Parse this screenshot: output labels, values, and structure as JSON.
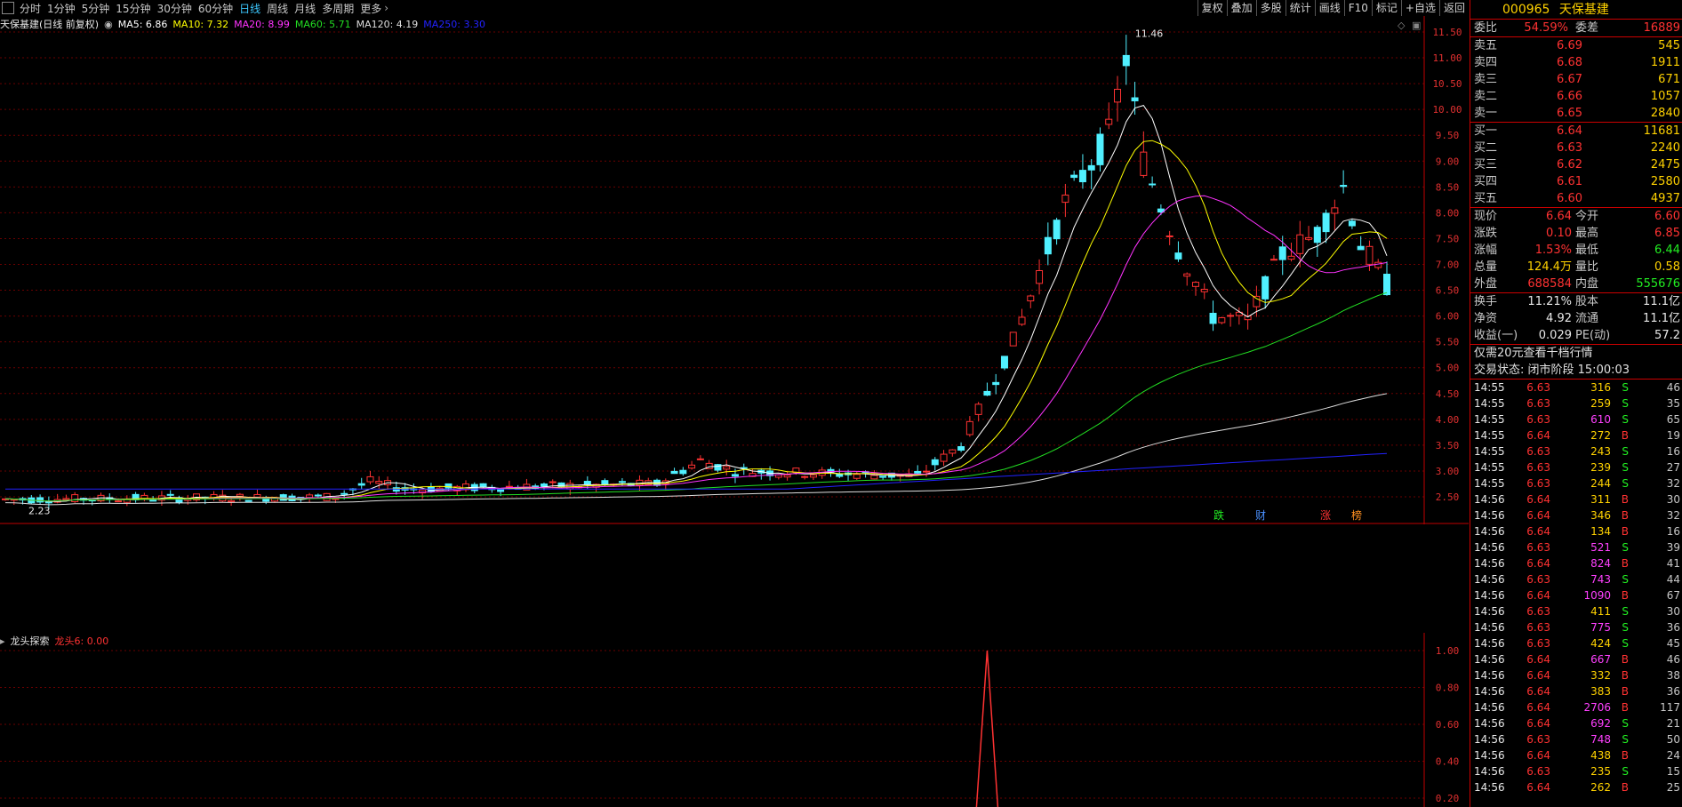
{
  "toolbar": {
    "periods": [
      "分时",
      "1分钟",
      "5分钟",
      "15分钟",
      "30分钟",
      "60分钟",
      "日线",
      "周线",
      "月线",
      "多周期",
      "更多"
    ],
    "active_period": "日线",
    "right_buttons": [
      "复权",
      "叠加",
      "多股",
      "统计",
      "画线",
      "F10",
      "标记",
      "+自选",
      "返回"
    ]
  },
  "chart": {
    "stock_title": "天保基建(日线 前复权)",
    "ma_legend": [
      {
        "label": "MA5: 6.86",
        "color": "#ffffff"
      },
      {
        "label": "MA10: 7.32",
        "color": "#ffff00"
      },
      {
        "label": "MA20: 8.99",
        "color": "#ff33ff"
      },
      {
        "label": "MA60: 5.71",
        "color": "#22dd22"
      },
      {
        "label": "MA120: 4.19",
        "color": "#dddddd"
      },
      {
        "label": "MA250: 3.30",
        "color": "#2222ff"
      }
    ],
    "high_label": "11.46",
    "low_label": "2.23",
    "event_marks": [
      {
        "label": "跌",
        "color": "#22ee22"
      },
      {
        "label": "财",
        "color": "#4a90ff"
      },
      {
        "label": "涨",
        "color": "#ff3232"
      },
      {
        "label": "榜",
        "color": "#ff9020"
      }
    ],
    "y_ticks": [
      "11.50",
      "11.00",
      "10.50",
      "10.00",
      "9.50",
      "9.00",
      "8.50",
      "8.00",
      "7.50",
      "7.00",
      "6.50",
      "6.00",
      "5.50",
      "5.00",
      "4.50",
      "4.00",
      "3.50",
      "3.00",
      "2.50"
    ],
    "colors": {
      "up": "#ff3232",
      "down": "#50f0ff",
      "grid": "#7a0000"
    }
  },
  "sub": {
    "name": "龙头探索",
    "value_label": "龙头6: 0.00",
    "y_ticks": [
      "1.00",
      "0.80",
      "0.60",
      "0.40",
      "0.20"
    ]
  },
  "panel": {
    "code": "000965",
    "name": "天保基建",
    "weibi": {
      "label": "委比",
      "value": "54.59%",
      "label2": "委差",
      "value2": "16889"
    },
    "asks": [
      {
        "label": "卖五",
        "price": "6.69",
        "vol": "545"
      },
      {
        "label": "卖四",
        "price": "6.68",
        "vol": "1911"
      },
      {
        "label": "卖三",
        "price": "6.67",
        "vol": "671"
      },
      {
        "label": "卖二",
        "price": "6.66",
        "vol": "1057"
      },
      {
        "label": "卖一",
        "price": "6.65",
        "vol": "2840"
      }
    ],
    "bids": [
      {
        "label": "买一",
        "price": "6.64",
        "vol": "11681"
      },
      {
        "label": "买二",
        "price": "6.63",
        "vol": "2240"
      },
      {
        "label": "买三",
        "price": "6.62",
        "vol": "2475"
      },
      {
        "label": "买四",
        "price": "6.61",
        "vol": "2580"
      },
      {
        "label": "买五",
        "price": "6.60",
        "vol": "4937"
      }
    ],
    "quote": [
      {
        "l1": "现价",
        "v1": "6.64",
        "c1": "red",
        "l2": "今开",
        "v2": "6.60",
        "c2": "red"
      },
      {
        "l1": "涨跌",
        "v1": "0.10",
        "c1": "red",
        "l2": "最高",
        "v2": "6.85",
        "c2": "red"
      },
      {
        "l1": "涨幅",
        "v1": "1.53%",
        "c1": "red",
        "l2": "最低",
        "v2": "6.44",
        "c2": "green"
      },
      {
        "l1": "总量",
        "v1": "124.4万",
        "c1": "yellow",
        "l2": "量比",
        "v2": "0.58",
        "c2": "yellow"
      },
      {
        "l1": "外盘",
        "v1": "688584",
        "c1": "red",
        "l2": "内盘",
        "v2": "555676",
        "c2": "green"
      }
    ],
    "fundamentals": [
      {
        "l1": "换手",
        "v1": "11.21%",
        "l2": "股本",
        "v2": "11.1亿"
      },
      {
        "l1": "净资",
        "v1": "4.92",
        "l2": "流通",
        "v2": "11.1亿"
      },
      {
        "l1": "收益(一)",
        "v1": "0.029",
        "l2": "PE(动)",
        "v2": "57.2"
      }
    ],
    "promo": "仅需20元查看千档行情",
    "status": "交易状态: 闭市阶段 15:00:03",
    "trades": [
      {
        "t": "14:55",
        "p": "6.63",
        "v": "316",
        "bs": "S",
        "n": "46"
      },
      {
        "t": "14:55",
        "p": "6.63",
        "v": "259",
        "bs": "S",
        "n": "35"
      },
      {
        "t": "14:55",
        "p": "6.63",
        "v": "610",
        "bs": "S",
        "n": "65"
      },
      {
        "t": "14:55",
        "p": "6.64",
        "v": "272",
        "bs": "B",
        "n": "19"
      },
      {
        "t": "14:55",
        "p": "6.63",
        "v": "243",
        "bs": "S",
        "n": "16"
      },
      {
        "t": "14:55",
        "p": "6.63",
        "v": "239",
        "bs": "S",
        "n": "27"
      },
      {
        "t": "14:55",
        "p": "6.63",
        "v": "244",
        "bs": "S",
        "n": "32"
      },
      {
        "t": "14:56",
        "p": "6.64",
        "v": "311",
        "bs": "B",
        "n": "30"
      },
      {
        "t": "14:56",
        "p": "6.64",
        "v": "346",
        "bs": "B",
        "n": "32"
      },
      {
        "t": "14:56",
        "p": "6.64",
        "v": "134",
        "bs": "B",
        "n": "16"
      },
      {
        "t": "14:56",
        "p": "6.63",
        "v": "521",
        "bs": "S",
        "n": "39"
      },
      {
        "t": "14:56",
        "p": "6.64",
        "v": "824",
        "bs": "B",
        "n": "41"
      },
      {
        "t": "14:56",
        "p": "6.63",
        "v": "743",
        "bs": "S",
        "n": "44"
      },
      {
        "t": "14:56",
        "p": "6.64",
        "v": "1090",
        "bs": "B",
        "n": "67"
      },
      {
        "t": "14:56",
        "p": "6.63",
        "v": "411",
        "bs": "S",
        "n": "30"
      },
      {
        "t": "14:56",
        "p": "6.63",
        "v": "775",
        "bs": "S",
        "n": "36"
      },
      {
        "t": "14:56",
        "p": "6.63",
        "v": "424",
        "bs": "S",
        "n": "45"
      },
      {
        "t": "14:56",
        "p": "6.64",
        "v": "667",
        "bs": "B",
        "n": "46"
      },
      {
        "t": "14:56",
        "p": "6.64",
        "v": "332",
        "bs": "B",
        "n": "38"
      },
      {
        "t": "14:56",
        "p": "6.64",
        "v": "383",
        "bs": "B",
        "n": "36"
      },
      {
        "t": "14:56",
        "p": "6.64",
        "v": "2706",
        "bs": "B",
        "n": "117"
      },
      {
        "t": "14:56",
        "p": "6.64",
        "v": "692",
        "bs": "S",
        "n": "21"
      },
      {
        "t": "14:56",
        "p": "6.63",
        "v": "748",
        "bs": "S",
        "n": "50"
      },
      {
        "t": "14:56",
        "p": "6.64",
        "v": "438",
        "bs": "B",
        "n": "24"
      },
      {
        "t": "14:56",
        "p": "6.63",
        "v": "235",
        "bs": "S",
        "n": "15"
      },
      {
        "t": "14:56",
        "p": "6.64",
        "v": "262",
        "bs": "B",
        "n": "25"
      }
    ]
  }
}
